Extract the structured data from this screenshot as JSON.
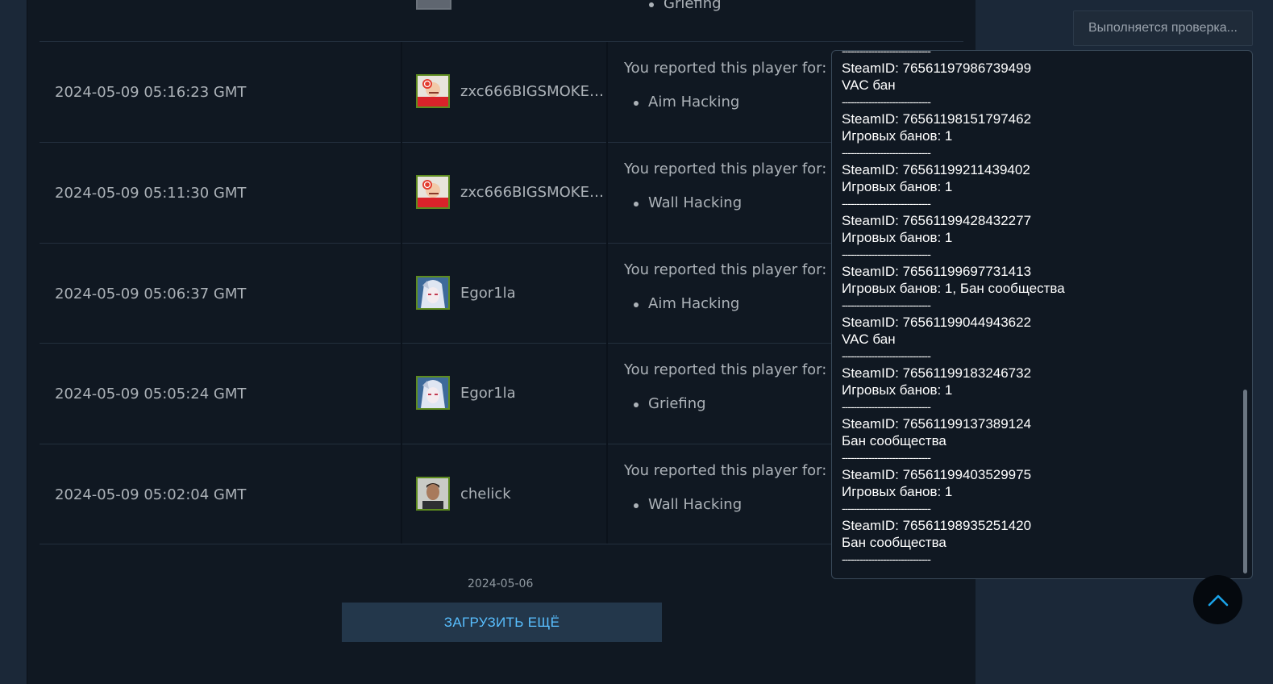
{
  "reports": [
    {
      "date": "2024-05-09 05:16:23 GMT",
      "player": "zxc666BIGSMOKE…",
      "reported_label": "You reported this player for:",
      "reason": "Aim Hacking",
      "avatar": "red-avatar"
    },
    {
      "date": "2024-05-09 05:11:30 GMT",
      "player": "zxc666BIGSMOKE…",
      "reported_label": "You reported this player for:",
      "reason": "Wall Hacking",
      "avatar": "red-avatar"
    },
    {
      "date": "2024-05-09 05:06:37 GMT",
      "player": "Egor1la",
      "reported_label": "You reported this player for:",
      "reason": "Aim Hacking",
      "avatar": "anime-avatar"
    },
    {
      "date": "2024-05-09 05:05:24 GMT",
      "player": "Egor1la",
      "reported_label": "You reported this player for:",
      "reason": "Griefing",
      "avatar": "anime-avatar"
    },
    {
      "date": "2024-05-09 05:02:04 GMT",
      "player": "chelick",
      "reported_label": "You reported this player for:",
      "reason": "Wall Hacking",
      "avatar": "photo-avatar"
    }
  ],
  "top_partial_reason": "Griefing",
  "page_date": "2024-05-06",
  "load_more_label": "ЗАГРУЗИТЬ ЕЩЁ",
  "check_status": "Выполняется проверка...",
  "popup": {
    "separator": "------------------------------",
    "entries": [
      {
        "id": "SteamID: 76561197986739499",
        "status": "VAC бан"
      },
      {
        "id": "SteamID: 76561198151797462",
        "status": "Игровых банов: 1"
      },
      {
        "id": "SteamID: 76561199211439402",
        "status": "Игровых банов: 1"
      },
      {
        "id": "SteamID: 76561199428432277",
        "status": "Игровых банов: 1"
      },
      {
        "id": "SteamID: 76561199697731413",
        "status": "Игровых банов: 1, Бан сообщества"
      },
      {
        "id": "SteamID: 76561199044943622",
        "status": "VAC бан"
      },
      {
        "id": "SteamID: 76561199183246732",
        "status": "Игровых банов: 1"
      },
      {
        "id": "SteamID: 76561199137389124",
        "status": "Бан сообщества"
      },
      {
        "id": "SteamID: 76561199403529975",
        "status": "Игровых банов: 1"
      },
      {
        "id": "SteamID: 76561198935251420",
        "status": "Бан сообщества"
      }
    ]
  },
  "colors": {
    "accent": "#59bfff",
    "avatar_border": "#5d8b1f",
    "panel": "#101822",
    "background": "#1b2838"
  }
}
